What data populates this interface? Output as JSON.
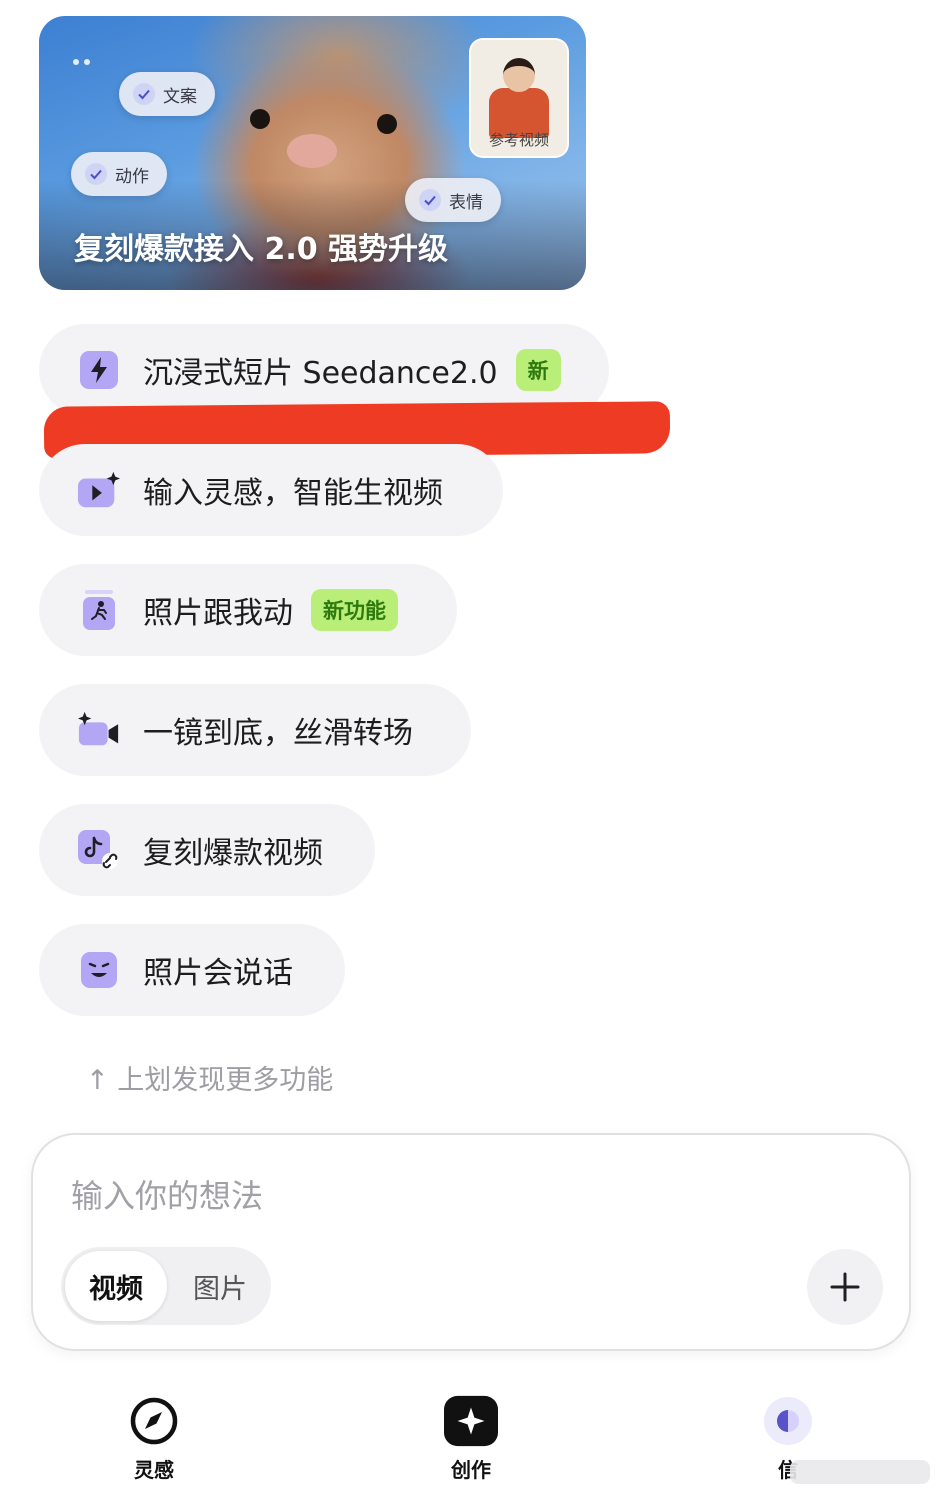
{
  "banner": {
    "title": "复刻爆款接入 2.0 强势升级",
    "chips": [
      "文案",
      "动作",
      "表情"
    ],
    "reference_label": "参考视频"
  },
  "features": [
    {
      "label": "沉浸式短片 Seedance2.0",
      "badge": "新",
      "icon": "lightning-icon"
    },
    {
      "label": "输入灵感，智能生视频",
      "icon": "video-sparkle-icon"
    },
    {
      "label": "照片跟我动",
      "badge": "新功能",
      "icon": "photo-motion-icon"
    },
    {
      "label": "一镜到底，丝滑转场",
      "icon": "camera-sparkle-icon"
    },
    {
      "label": "复刻爆款视频",
      "icon": "tiktok-link-icon"
    },
    {
      "label": "照片会说话",
      "icon": "smile-face-icon"
    }
  ],
  "hint": "↑ 上划发现更多功能",
  "composer": {
    "placeholder": "输入你的想法",
    "modes": [
      "视频",
      "图片"
    ],
    "selected_mode": "视频"
  },
  "nav": {
    "items": [
      {
        "label": "灵感",
        "icon": "compass-icon"
      },
      {
        "label": "创作",
        "icon": "sparkle-icon"
      },
      {
        "label": "信",
        "icon": "profile-icon"
      }
    ]
  },
  "colors": {
    "accent_purple": "#b3a6f5",
    "badge_green": "#b9ef78",
    "annotation_red": "#ee3b24"
  }
}
